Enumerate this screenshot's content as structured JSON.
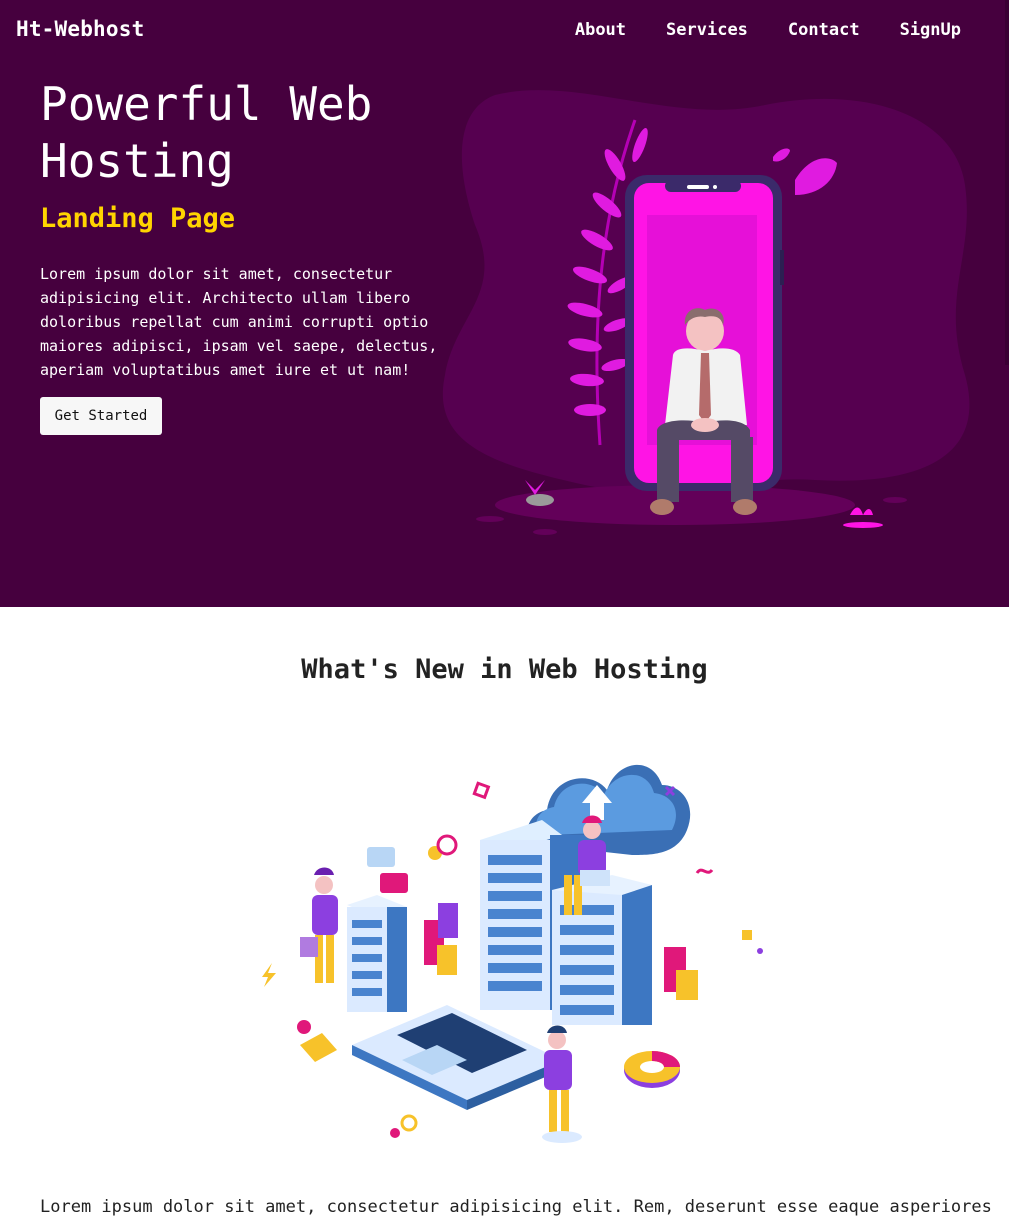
{
  "header": {
    "brand": "Ht-Webhost",
    "nav": [
      "About",
      "Services",
      "Contact",
      "SignUp"
    ]
  },
  "hero": {
    "title": "Powerful Web Hosting",
    "subtitle": "Landing Page",
    "text": "Lorem ipsum dolor sit amet, consectetur adipisicing elit. Architecto ullam libero doloribus repellat cum animi corrupti optio maiores adipisci, ipsam vel saepe, delectus, aperiam voluptatibus amet iure et ut nam!",
    "cta_label": "Get Started"
  },
  "section": {
    "title": "What's New in Web Hosting",
    "text": "Lorem ipsum dolor sit amet, consectetur adipisicing elit. Rem, deserunt esse eaque asperiores"
  },
  "colors": {
    "hero_bg": "#46003e",
    "accent_yellow": "#ffd400",
    "phone_screen": "#ff14e5",
    "leaf_magenta": "#e01be0"
  }
}
